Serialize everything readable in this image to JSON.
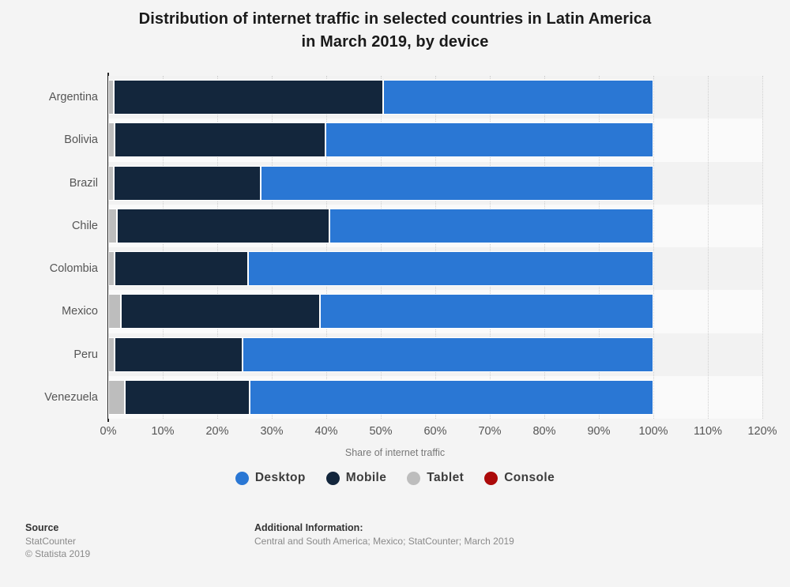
{
  "title": {
    "line1": "Distribution of internet traffic in selected countries in Latin America",
    "line2": "in March 2019, by device"
  },
  "axis": {
    "x_title": "Share of internet traffic",
    "x_ticks": [
      "0%",
      "10%",
      "20%",
      "30%",
      "40%",
      "50%",
      "60%",
      "70%",
      "80%",
      "90%",
      "100%",
      "110%",
      "120%"
    ]
  },
  "legend": {
    "items": [
      {
        "label": "Desktop",
        "color": "#2a77d4"
      },
      {
        "label": "Mobile",
        "color": "#13263c"
      },
      {
        "label": "Tablet",
        "color": "#bdbdbd"
      },
      {
        "label": "Console",
        "color": "#ac0a0a"
      }
    ]
  },
  "footer": {
    "source_heading": "Source",
    "source_name": "StatCounter",
    "copyright": "© Statista 2019",
    "info_heading": "Additional Information:",
    "info_text": "Central and South America; Mexico; StatCounter; March 2019"
  },
  "chart_data": {
    "type": "bar",
    "orientation": "horizontal",
    "stacked": true,
    "title": "Distribution of internet traffic in selected countries in Latin America in March 2019, by device",
    "xlabel": "Share of internet traffic",
    "ylabel": "",
    "xlim": [
      0,
      120
    ],
    "xticks": [
      0,
      10,
      20,
      30,
      40,
      50,
      60,
      70,
      80,
      90,
      100,
      110,
      120
    ],
    "grid": "vertical-dotted",
    "legend_position": "bottom",
    "categories": [
      "Argentina",
      "Bolivia",
      "Brazil",
      "Chile",
      "Colombia",
      "Mexico",
      "Peru",
      "Venezuela"
    ],
    "series": [
      {
        "name": "Tablet",
        "color": "#bdbdbd",
        "values": [
          1.0,
          1.1,
          1.0,
          1.6,
          1.1,
          2.3,
          1.1,
          3.1
        ]
      },
      {
        "name": "Mobile",
        "color": "#13263c",
        "values": [
          49.5,
          38.7,
          26.9,
          39.0,
          24.5,
          36.6,
          23.5,
          22.9
        ]
      },
      {
        "name": "Desktop",
        "color": "#2a77d4",
        "values": [
          49.5,
          60.2,
          72.1,
          59.4,
          74.4,
          61.1,
          75.4,
          74.0
        ]
      },
      {
        "name": "Console",
        "color": "#ac0a0a",
        "values": [
          0.0,
          0.0,
          0.0,
          0.0,
          0.0,
          0.0,
          0.0,
          0.0
        ]
      }
    ],
    "totals": [
      100,
      100,
      100,
      100,
      100,
      100,
      100,
      100
    ]
  }
}
